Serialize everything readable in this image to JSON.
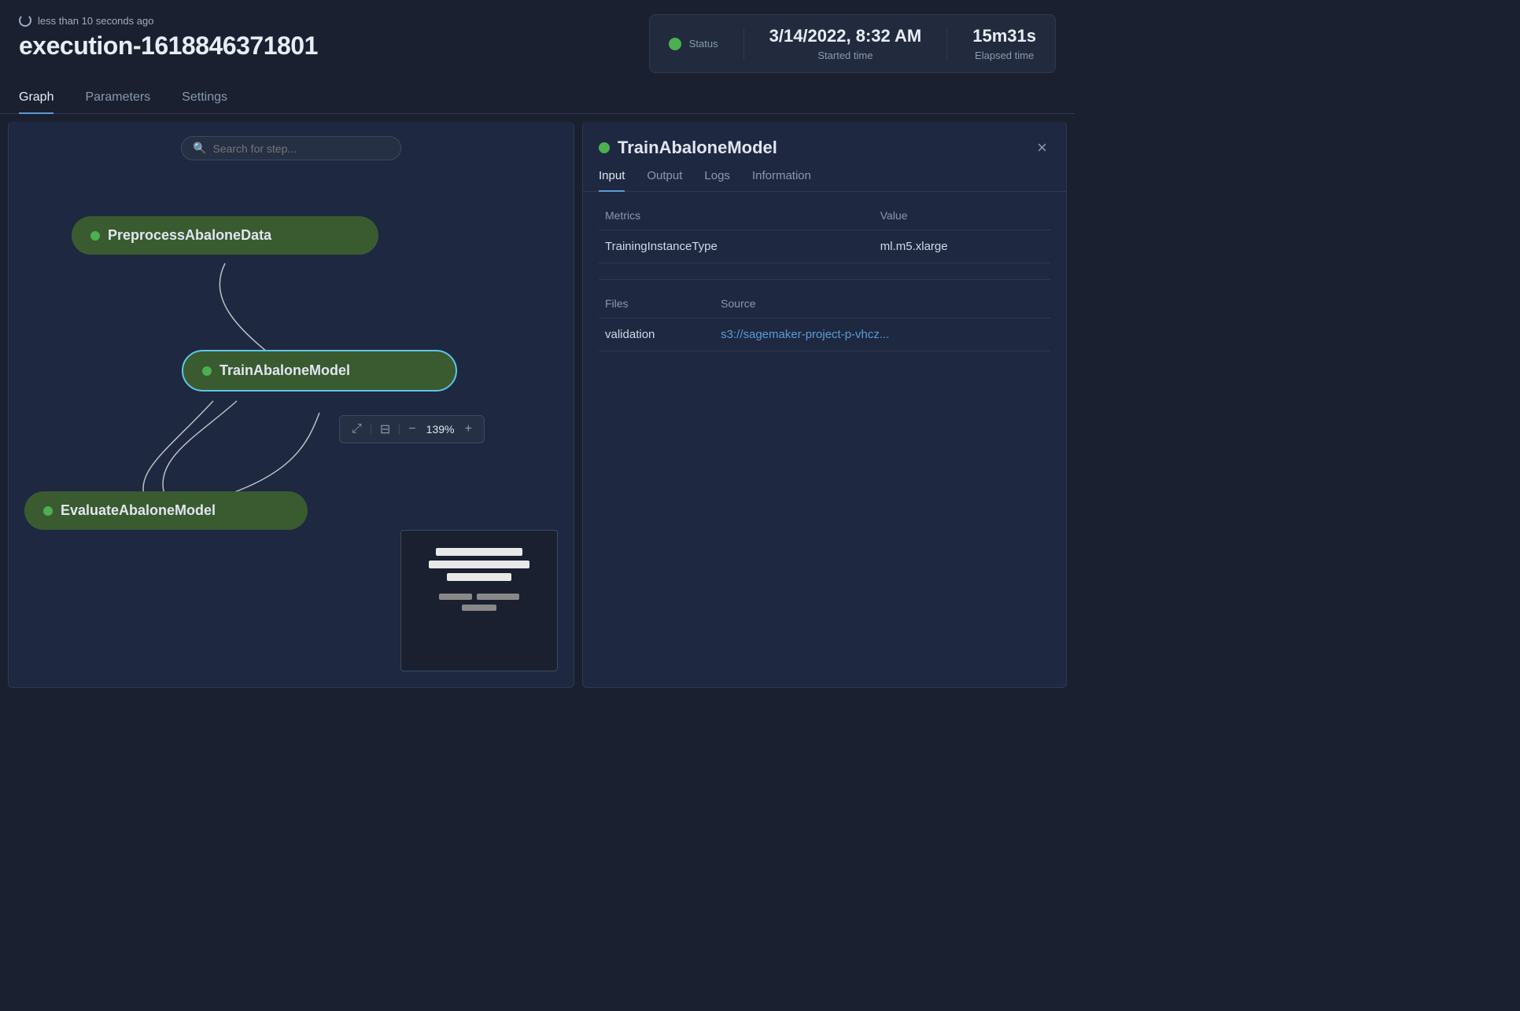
{
  "header": {
    "refresh_label": "less than 10 seconds ago",
    "execution_title": "execution-1618846371801",
    "status": {
      "dot_color": "#4caf50",
      "status_label": "Status",
      "started_time": "3/14/2022, 8:32 AM",
      "started_label": "Started time",
      "elapsed_time": "15m31s",
      "elapsed_label": "Elapsed time"
    }
  },
  "tabs": [
    "Graph",
    "Parameters",
    "Settings"
  ],
  "active_tab": "Graph",
  "graph": {
    "search_placeholder": "Search for step...",
    "nodes": [
      {
        "id": "preprocess",
        "label": "PreprocessAbaloneData"
      },
      {
        "id": "train",
        "label": "TrainAbaloneModel"
      },
      {
        "id": "evaluate",
        "label": "EvaluateAbaloneModel"
      }
    ],
    "zoom_level": "139%",
    "zoom_controls": {
      "fit_icon": "⤢",
      "minus_icon": "−",
      "plus_icon": "+"
    }
  },
  "right_panel": {
    "title": "TrainAbaloneModel",
    "close_label": "×",
    "tabs": [
      "Input",
      "Output",
      "Logs",
      "Information"
    ],
    "active_tab": "Input",
    "metrics_header": "Metrics",
    "value_header": "Value",
    "metrics_rows": [
      {
        "metric": "TrainingInstanceType",
        "value": "ml.m5.xlarge"
      }
    ],
    "files_header": "Files",
    "source_header": "Source",
    "files_rows": [
      {
        "file": "validation",
        "source": "s3://sagemaker-project-p-vhcz..."
      }
    ]
  }
}
